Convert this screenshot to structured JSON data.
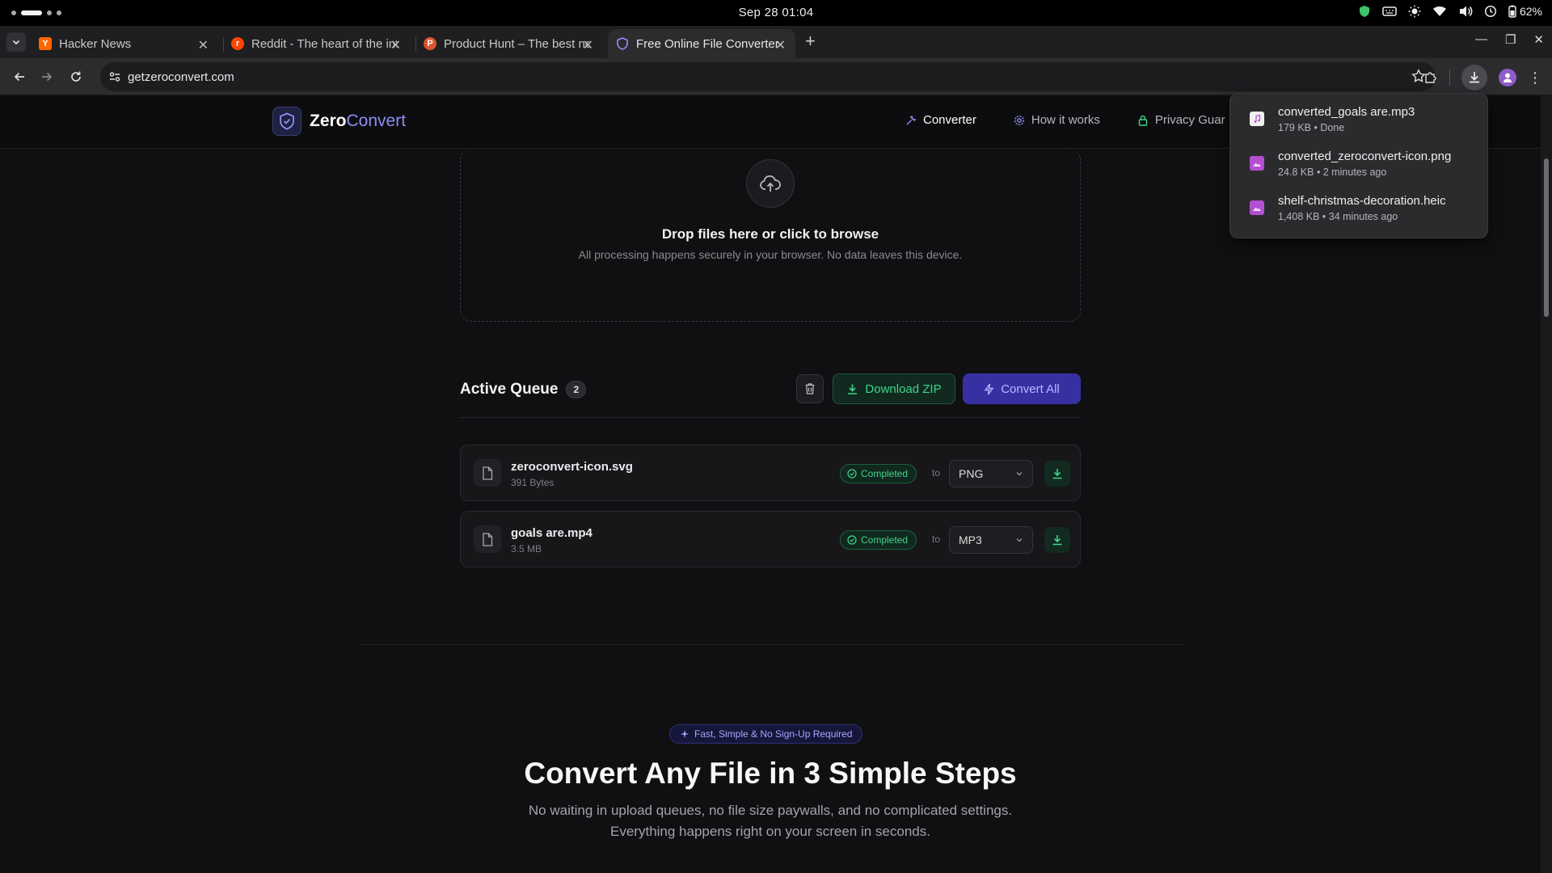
{
  "os": {
    "clock": "Sep 28  01:04",
    "battery": "62%"
  },
  "tabs": [
    {
      "title": "Hacker News",
      "favicon": "Y",
      "color": "#ff6600"
    },
    {
      "title": "Reddit - The heart of the internet",
      "favicon": "r",
      "color": "#ff4500"
    },
    {
      "title": "Product Hunt – The best new products",
      "favicon": "P",
      "color": "#da552f"
    },
    {
      "title": "Free Online File Converter",
      "favicon": "shield",
      "color": "#6d73f0"
    }
  ],
  "browser": {
    "url": "getzeroconvert.com"
  },
  "site": {
    "logo_zero": "Zero",
    "logo_convert": "Convert",
    "nav": [
      {
        "label": "Converter",
        "icon": "wrench-icon"
      },
      {
        "label": "How it works",
        "icon": "gear-icon"
      },
      {
        "label": "Privacy Guar",
        "icon": "lock-icon"
      }
    ]
  },
  "dropzone": {
    "title": "Drop files here or click to browse",
    "subtitle": "All processing happens securely in your browser. No data leaves this device."
  },
  "queue": {
    "title": "Active Queue",
    "count": "2",
    "download_zip": "Download ZIP",
    "convert_all": "Convert All",
    "to_label": "to",
    "items": [
      {
        "name": "zeroconvert-icon.svg",
        "size": "391 Bytes",
        "status": "Completed",
        "format": "PNG"
      },
      {
        "name": "goals are.mp4",
        "size": "3.5 MB",
        "status": "Completed",
        "format": "MP3"
      }
    ]
  },
  "hero": {
    "pill": "Fast, Simple & No Sign-Up Required",
    "title": "Convert Any File in 3 Simple Steps",
    "subtitle_line1": "No waiting in upload queues, no file size paywalls, and no complicated settings.",
    "subtitle_line2": "Everything happens right on your screen in seconds."
  },
  "downloads": [
    {
      "name": "converted_goals are.mp3",
      "meta": "179 KB • Done",
      "icon": "audio-file-icon",
      "color": "#f0f0f0"
    },
    {
      "name": "converted_zeroconvert-icon.png",
      "meta": "24.8 KB • 2 minutes ago",
      "icon": "image-file-icon",
      "color": "#b44fd1"
    },
    {
      "name": "shelf-christmas-decoration.heic",
      "meta": "1,408 KB • 34 minutes ago",
      "icon": "image-file-icon",
      "color": "#b44fd1"
    }
  ]
}
